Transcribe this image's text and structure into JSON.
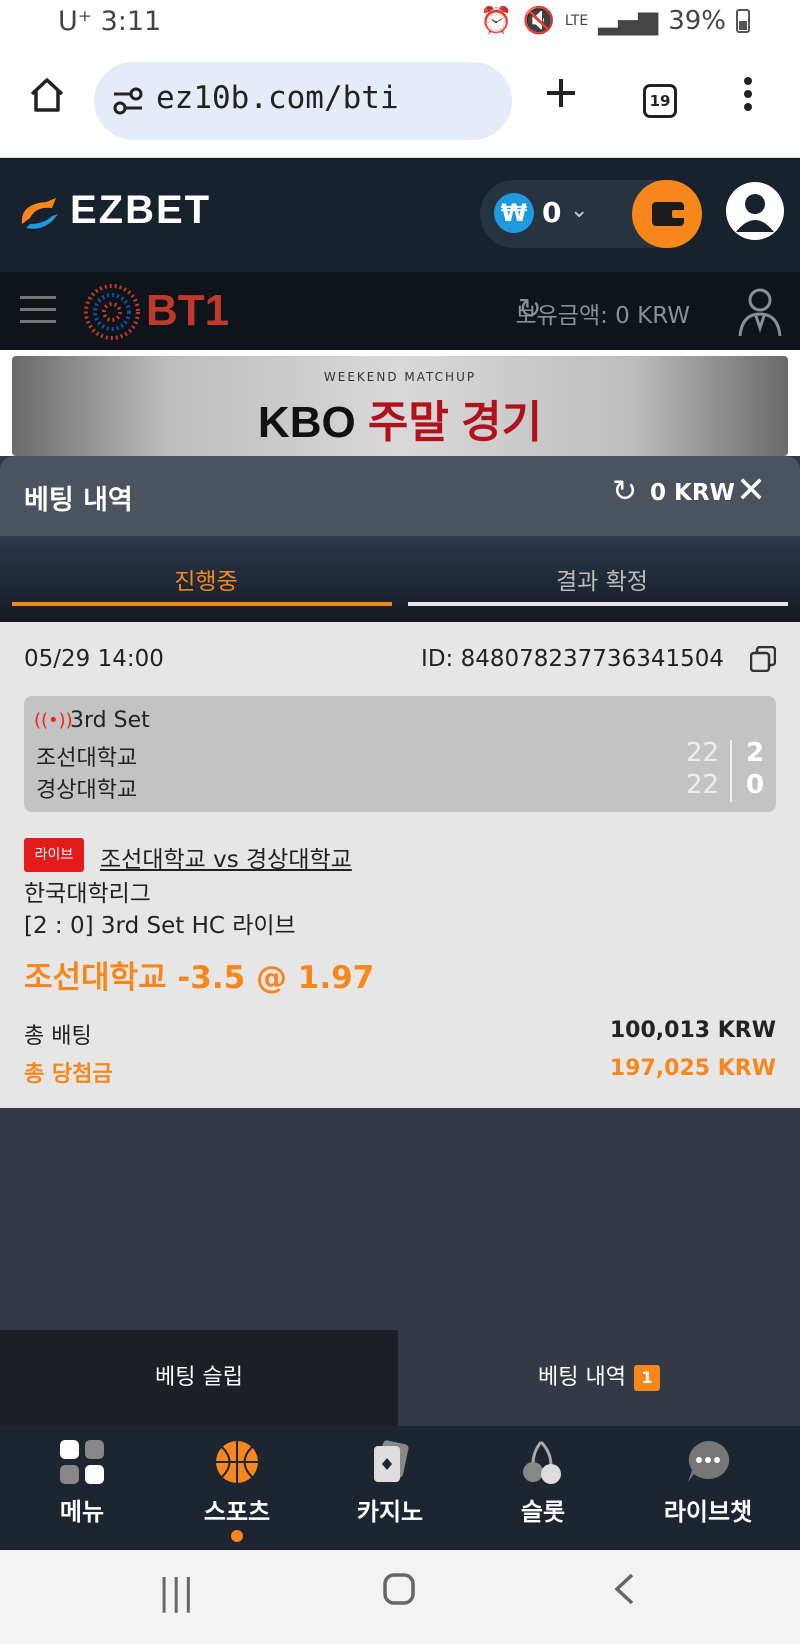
{
  "status_bar": {
    "carrier_time": "U⁺ 3:11",
    "battery": "39%",
    "network": "LTE"
  },
  "browser": {
    "url": "ez10b.com/bti",
    "tab_count": "19"
  },
  "site": {
    "logo": "EZBET",
    "wallet_currency_symbol": "₩",
    "wallet_amount": "0"
  },
  "sportsbook": {
    "brand": "BT1",
    "balance_label": "보유금액: 0 KRW"
  },
  "banner": {
    "small_text": "WEEKEND MATCHUP",
    "title_part1": "KBO ",
    "title_part2": "주말 경기"
  },
  "bet_panel": {
    "title": "베팅 내역",
    "balance": "0 KRW",
    "tabs": {
      "active": "진행중",
      "inactive": "결과 확정"
    }
  },
  "bet": {
    "date": "05/29 14:00",
    "id": "ID: 848078237736341504",
    "live_set": "3rd Set",
    "team1": "조선대학교",
    "team2": "경상대학교",
    "team1_points": "22",
    "team2_points": "22",
    "team1_sets": "2",
    "team2_sets": "0",
    "live_badge": "라이브",
    "match": "조선대학교 vs 경상대학교",
    "league": "한국대학리그",
    "market": "[2 : 0] 3rd Set HC 라이브",
    "selection": "조선대학교 -3.5 @ 1.97",
    "total_stake_label": "총 배팅",
    "total_stake": "100,013 KRW",
    "total_win_label": "총 당첨금",
    "total_win": "197,025 KRW"
  },
  "slip_tabs": {
    "slip": "베팅 슬립",
    "history": "베팅 내역",
    "history_count": "1"
  },
  "bottom_nav": [
    {
      "label": "메뉴",
      "icon": "grid-icon"
    },
    {
      "label": "스포츠",
      "icon": "basketball-icon"
    },
    {
      "label": "카지노",
      "icon": "cards-icon"
    },
    {
      "label": "슬롯",
      "icon": "cherry-icon"
    },
    {
      "label": "라이브챗",
      "icon": "chat-icon"
    }
  ],
  "colors": {
    "accent": "#f7871c",
    "header_bg": "#17222d",
    "panel_bg": "#333a46",
    "live_red": "#e41b1b"
  }
}
